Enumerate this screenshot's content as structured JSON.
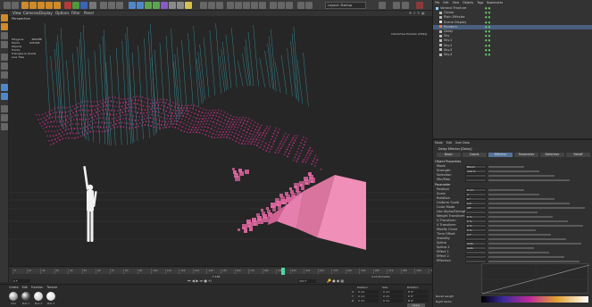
{
  "app": {
    "menus": [
      "File",
      "Edit",
      "Create",
      "Select",
      "Tools",
      "Mesh",
      "Snap",
      "Animate",
      "Simulate",
      "Render",
      "Sculpt",
      "MoGraph",
      "Character",
      "Pipeline",
      "Plugins",
      "Script",
      "Window",
      "Help"
    ],
    "layout_label": "Layout: Startup"
  },
  "viewport": {
    "menu": [
      "View",
      "Cameras",
      "Display",
      "Options",
      "Filter",
      "Panel"
    ],
    "name": "Perspective",
    "hud_left": [
      "Polygons",
      "Points",
      "Objects",
      "Tracks",
      "Triangles & Quads",
      "Line Tiles"
    ],
    "hud_values": [
      "466286",
      "935328",
      "",
      "",
      "",
      ""
    ],
    "hud_right": "Interactive Preview (25fps)",
    "camera_label": "Default Camera"
  },
  "timeline": {
    "ticks": [
      "0",
      "10",
      "20",
      "30",
      "40",
      "50",
      "60",
      "70",
      "80",
      "90",
      "100",
      "110",
      "120",
      "130",
      "140",
      "150",
      "160",
      "170",
      "180",
      "190",
      "200",
      "210",
      "220",
      "230",
      "240",
      "250",
      "260",
      "270",
      "280",
      "290",
      "300"
    ],
    "current": "F 156",
    "start": "0 F",
    "end": "300 F",
    "fps_label": "4 of 16 tracks"
  },
  "coordinates": {
    "headers": [
      "Position",
      "Size",
      "Rotation"
    ],
    "rows": [
      {
        "axis": "X",
        "pos": "0 cm",
        "size": "0 cm",
        "rot": "H 0°"
      },
      {
        "axis": "Y",
        "pos": "0 cm",
        "size": "0 cm",
        "rot": "P 0°"
      },
      {
        "axis": "Z",
        "pos": "0 cm",
        "size": "0 cm",
        "rot": "B 0°"
      }
    ],
    "apply": "Apply"
  },
  "materials": {
    "menu": [
      "Create",
      "Edit",
      "Function",
      "Texture"
    ],
    "items": [
      "Mat",
      "Mat.1",
      "Mat.2",
      "Mat.3"
    ]
  },
  "objects": {
    "menu": [
      "File",
      "Edit",
      "View",
      "Objects",
      "Tags",
      "Bookmarks"
    ],
    "items": [
      "Voronoi Fracture",
      "Cloner",
      "Plain Effector",
      "Scene Display",
      "Random",
      "Delay",
      "Sky",
      "Sky.1",
      "Sky.2",
      "Sky.3",
      "Sky.4"
    ]
  },
  "attributes": {
    "menu": [
      "Mode",
      "Edit",
      "User Data"
    ],
    "title": "Delay Effector [Delay]",
    "tabs": [
      "Basic",
      "Coord.",
      "Effector",
      "Parameter",
      "Deformer",
      "Falloff"
    ],
    "section": "Object Properties",
    "props": [
      {
        "label": "Mode",
        "value": "Blend"
      },
      {
        "label": "Strength",
        "value": "100 %"
      },
      {
        "label": "Selection",
        "value": ""
      },
      {
        "label": "Min/Max",
        "value": ""
      }
    ],
    "section2": "Parameter",
    "params": [
      {
        "label": "Position",
        "value": "0 cm"
      },
      {
        "label": "Scale",
        "value": "1"
      },
      {
        "label": "Rotation",
        "value": "0 °"
      },
      {
        "label": "Uniform Scale",
        "value": "0.5"
      },
      {
        "label": "Color Mode",
        "value": "Off"
      },
      {
        "label": "Use Alpha/Strength",
        "value": ""
      },
      {
        "label": "Weight Transform",
        "value": "0 %"
      },
      {
        "label": "U Transform",
        "value": "0 %"
      },
      {
        "label": "V Transform",
        "value": "0 %"
      },
      {
        "label": "Modify Clone",
        "value": "0 %"
      },
      {
        "label": "Time Offset",
        "value": "0 F"
      },
      {
        "label": "Visibility",
        "value": ""
      },
      {
        "label": "Spline",
        "value": "Auto"
      },
      {
        "label": "Spline.1",
        "value": "Auto"
      },
      {
        "label": "Effect 1",
        "value": ""
      },
      {
        "label": "Effect 2",
        "value": ""
      },
      {
        "label": "Effectors",
        "value": ""
      }
    ],
    "footer": [
      "Recall Length",
      "Right Vector"
    ]
  },
  "colors": {
    "accent": "#6b8fbf",
    "magenta": "#d0308f",
    "cyan": "#3ab7c4",
    "pink_block": "#f08fb8"
  }
}
